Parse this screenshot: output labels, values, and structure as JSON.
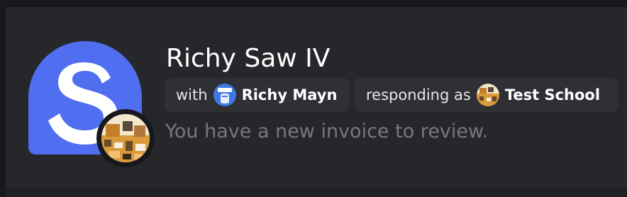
{
  "notification": {
    "title": "Richy Saw IV",
    "with_label": "with",
    "with_name": "Richy Mayn",
    "responding_label": "responding as",
    "responding_name": "Test School",
    "message": "You have a new invoice to review."
  },
  "icons": {
    "main_avatar": "s-logo-icon",
    "badge_avatar": "school-avatar-icon",
    "with_avatar": "person-avatar-icon",
    "responding_avatar": "school-avatar-icon"
  },
  "colors": {
    "background": "#17181c",
    "card": "#26272b",
    "chip": "#2f3035",
    "brand_blue": "#4f6ef0",
    "muted_text": "#77787f"
  }
}
